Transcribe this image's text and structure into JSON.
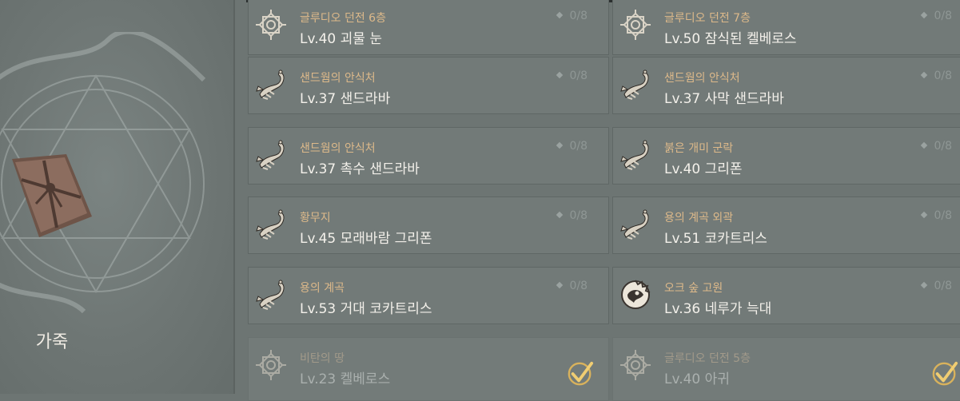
{
  "material": {
    "name": "가죽",
    "icon": "leather-bundle-icon"
  },
  "entries": [
    {
      "region": "글루디오 던전 6층",
      "monster": "Lv.40 괴물 눈",
      "count": "0/8",
      "icon": "star-seal-icon",
      "completed": false
    },
    {
      "region": "글루디오 던전 7층",
      "monster": "Lv.50 잠식된 켈베로스",
      "count": "0/8",
      "icon": "star-seal-icon",
      "completed": false
    },
    {
      "region": "샌드웜의 안식처",
      "monster": "Lv.37 샌드라바",
      "count": "0/8",
      "icon": "scorpion-icon",
      "completed": false
    },
    {
      "region": "샌드웜의 안식처",
      "monster": "Lv.37 사막 샌드라바",
      "count": "0/8",
      "icon": "scorpion-icon",
      "completed": false
    },
    {
      "region": "샌드웜의 안식처",
      "monster": "Lv.37 촉수 샌드라바",
      "count": "0/8",
      "icon": "scorpion-icon",
      "completed": false
    },
    {
      "region": "붉은 개미 군락",
      "monster": "Lv.40 그리폰",
      "count": "0/8",
      "icon": "scorpion-icon",
      "completed": false
    },
    {
      "region": "황무지",
      "monster": "Lv.45 모래바람 그리폰",
      "count": "0/8",
      "icon": "scorpion-icon",
      "completed": false
    },
    {
      "region": "용의 계곡 외곽",
      "monster": "Lv.51 코카트리스",
      "count": "0/8",
      "icon": "scorpion-icon",
      "completed": false
    },
    {
      "region": "용의 계곡",
      "monster": "Lv.53 거대 코카트리스",
      "count": "0/8",
      "icon": "scorpion-icon",
      "completed": false
    },
    {
      "region": "오크 숲 고원",
      "monster": "Lv.36 네루가 늑대",
      "count": "0/8",
      "icon": "orc-crest-icon",
      "completed": false
    },
    {
      "region": "비탄의 땅",
      "monster": "Lv.23 켈베로스",
      "count": "",
      "icon": "star-seal-icon",
      "completed": true
    },
    {
      "region": "글루디오 던전 5층",
      "monster": "Lv.40 아귀",
      "count": "",
      "icon": "star-seal-icon",
      "completed": true
    }
  ],
  "colors": {
    "region": "#ddb98a",
    "monster": "#f3f0ea",
    "panel": "#727a78",
    "check": "#d9b25c"
  }
}
